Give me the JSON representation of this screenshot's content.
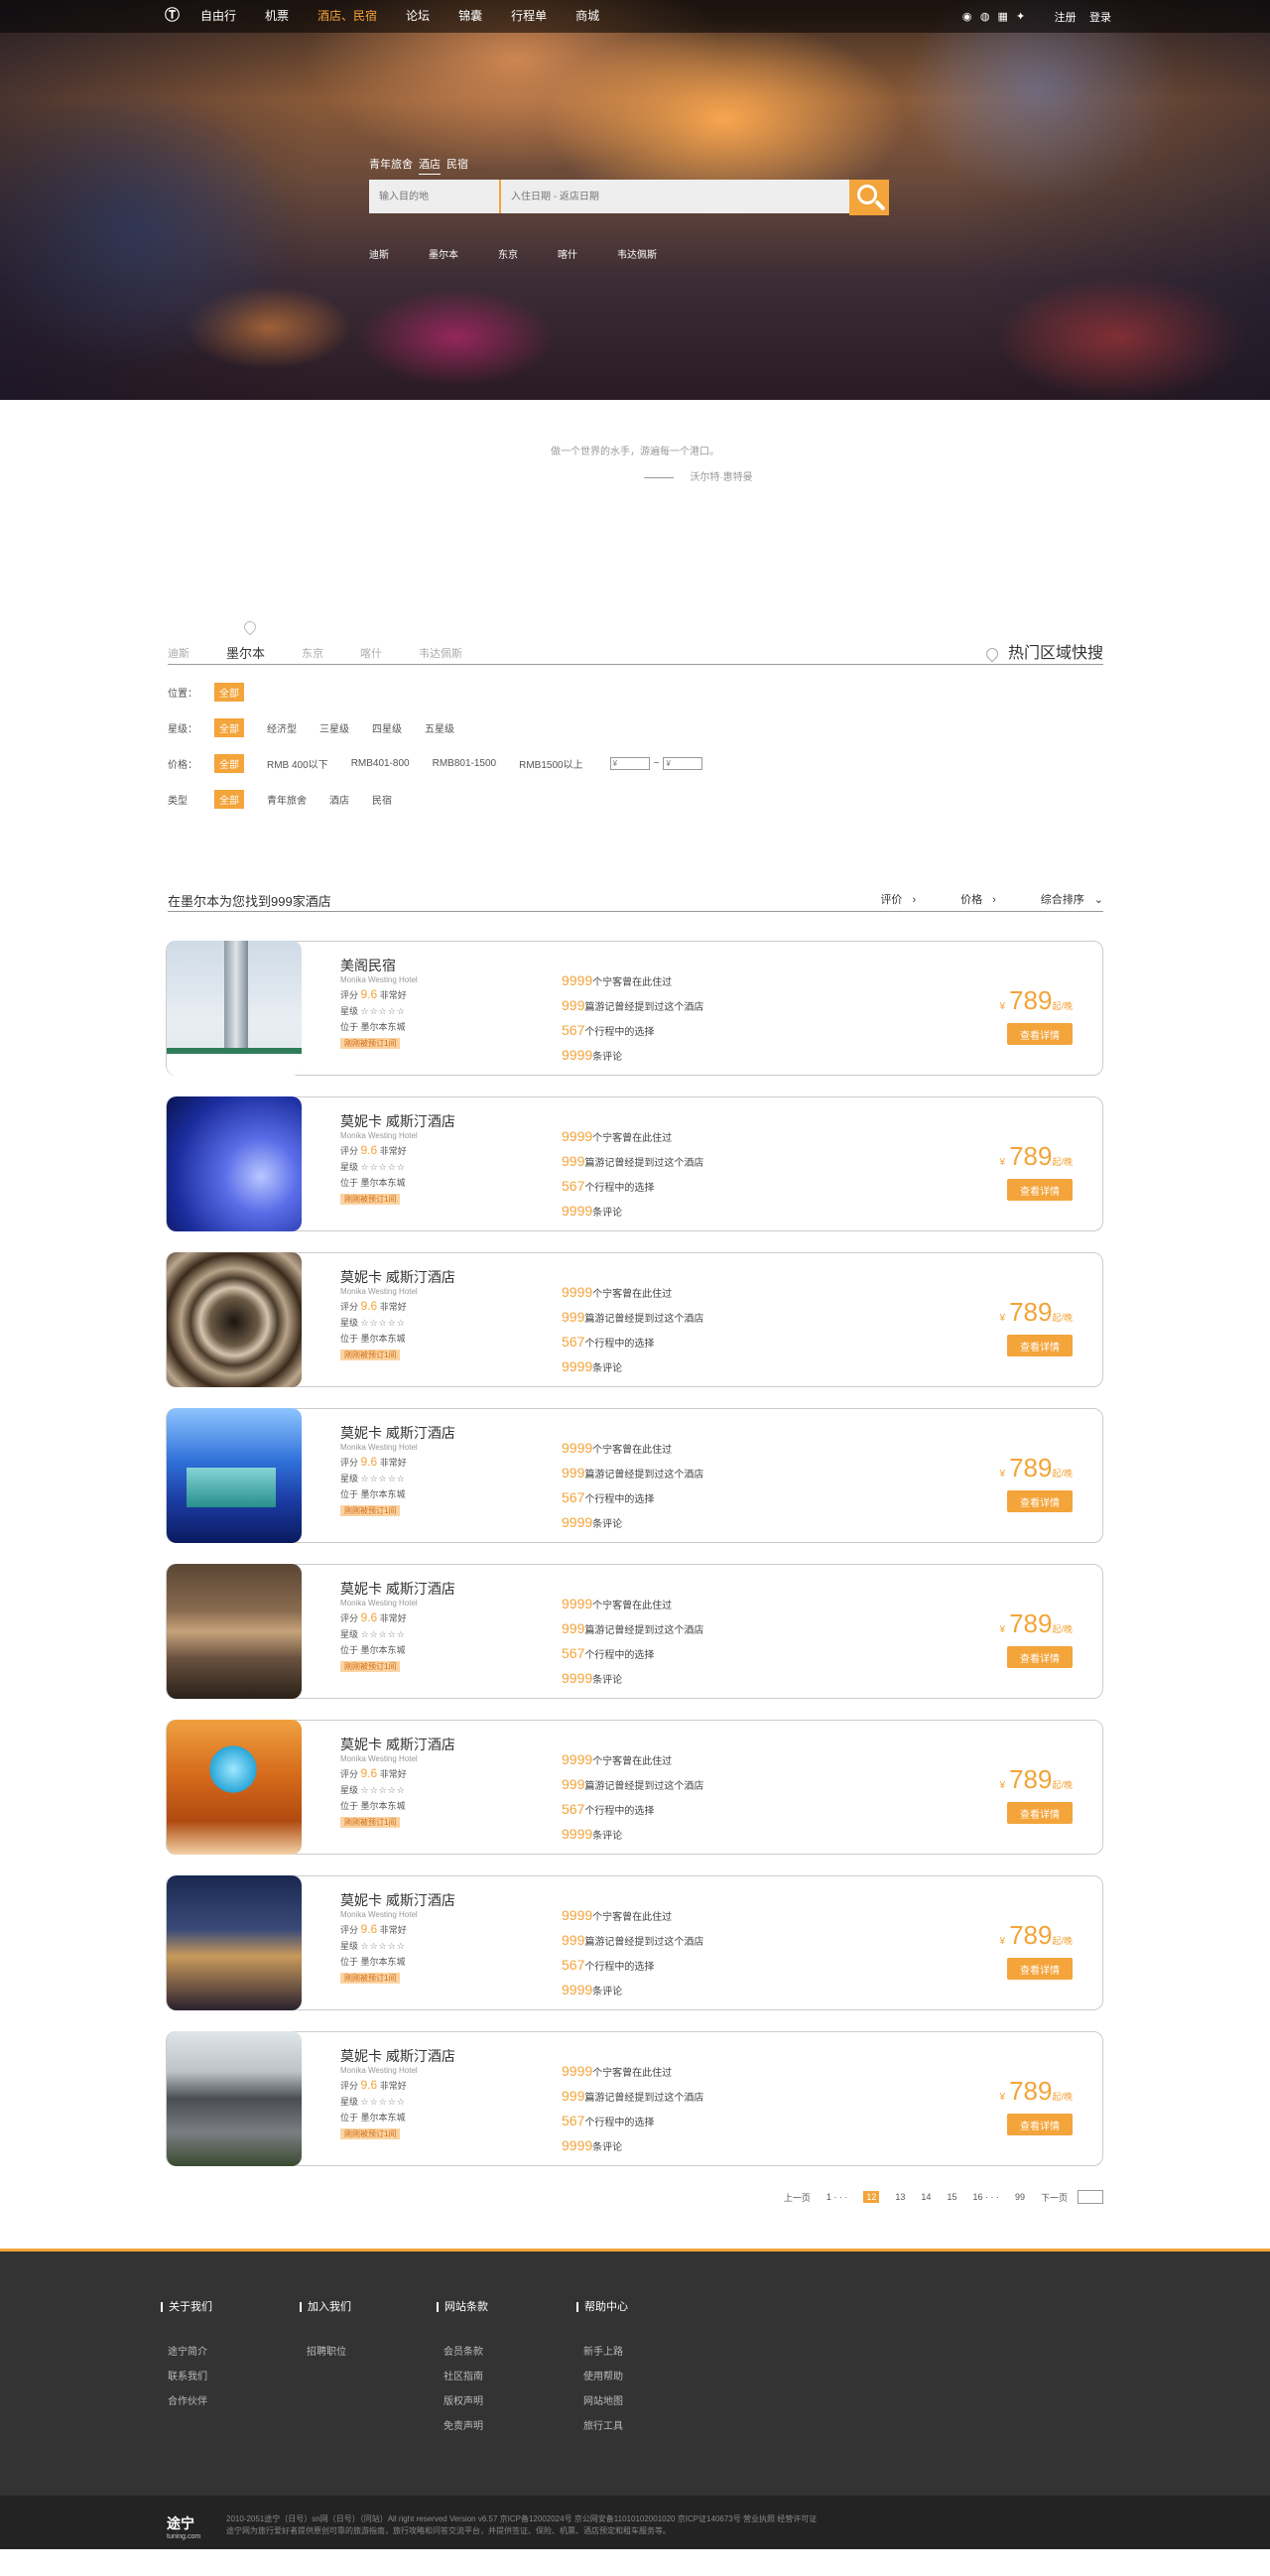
{
  "colors": {
    "accent": "#f3a43a",
    "footer_bg": "#333333",
    "bottom_bg": "#232323"
  },
  "header": {
    "logo_icon": "tuning-logo-icon",
    "nav": [
      "自由行",
      "机票",
      "酒店、民宿",
      "论坛",
      "锦囊",
      "行程单",
      "商城"
    ],
    "active_nav": "酒店、民宿",
    "social_icons": [
      "qq-icon",
      "wechat-icon",
      "grid-icon",
      "twitter-icon"
    ],
    "register": "注册",
    "login": "登录"
  },
  "hero": {
    "tabs": [
      "青年旅舍",
      "酒店",
      "民宿"
    ],
    "active_tab": "酒店",
    "destination_placeholder": "输入目的地",
    "date_placeholder": "入住日期 - 返店日期",
    "hot_cities": [
      "迪斯",
      "墨尔本",
      "东京",
      "喀什",
      "韦达佩斯"
    ]
  },
  "quote": {
    "text": "做一个世界的水手，游遍每一个港口。",
    "author": "沃尔特·惠特曼"
  },
  "city_tabs": {
    "items": [
      "迪斯",
      "墨尔本",
      "东京",
      "喀什",
      "韦达佩斯"
    ],
    "active": "墨尔本",
    "hot_area": "热门区域快搜"
  },
  "filters": {
    "location": {
      "label": "位置：",
      "options": [
        "全部"
      ]
    },
    "stars": {
      "label": "星级：",
      "options": [
        "全部",
        "经济型",
        "三星级",
        "四星级",
        "五星级"
      ]
    },
    "price": {
      "label": "价格：",
      "options": [
        "全部",
        "RMB 400以下",
        "RMB401-800",
        "RMB801-1500",
        "RMB1500以上"
      ],
      "min_placeholder": "¥",
      "sep": "~",
      "max_placeholder": "¥"
    },
    "type": {
      "label": "类型",
      "options": [
        "全部",
        "青年旅舍",
        "酒店",
        "民宿"
      ]
    }
  },
  "results": {
    "title": "在墨尔本为您找到999家酒店",
    "sorts": [
      "评价",
      "价格",
      "综合排序"
    ],
    "sort_icons": [
      "chevron-right-icon",
      "chevron-right-icon",
      "chevron-down-icon"
    ]
  },
  "hotels": [
    {
      "name": "美阁民宿",
      "en": "Monika Westing Hotel",
      "score_label": "评分",
      "score": "9.6",
      "score_desc": "非常好",
      "stars_label": "星级",
      "stars": "☆☆☆☆☆",
      "location": "位于 墨尔本东城",
      "tag": "刚刚被预订1间",
      "guests": "9999",
      "guests_text": "个宁客曾在此住过",
      "notes": "999",
      "notes_text": "篇游记曾经提到过这个酒店",
      "plans": "567",
      "plans_text": "个行程中的选择",
      "reviews": "9999",
      "reviews_text": "条评论",
      "currency": "¥",
      "price": "789",
      "unit": "起/晚",
      "button": "查看详情"
    },
    {
      "name": "莫妮卡 威斯汀酒店",
      "en": "Monika Westing Hotel",
      "score_label": "评分",
      "score": "9.6",
      "score_desc": "非常好",
      "stars_label": "星级",
      "stars": "☆☆☆☆☆",
      "location": "位于 墨尔本东城",
      "tag": "刚刚被预订1间",
      "guests": "9999",
      "guests_text": "个宁客曾在此住过",
      "notes": "999",
      "notes_text": "篇游记曾经提到过这个酒店",
      "plans": "567",
      "plans_text": "个行程中的选择",
      "reviews": "9999",
      "reviews_text": "条评论",
      "currency": "¥",
      "price": "789",
      "unit": "起/晚",
      "button": "查看详情"
    },
    {
      "name": "莫妮卡 威斯汀酒店",
      "en": "Monika Westing Hotel",
      "score_label": "评分",
      "score": "9.6",
      "score_desc": "非常好",
      "stars_label": "星级",
      "stars": "☆☆☆☆☆",
      "location": "位于 墨尔本东城",
      "tag": "刚刚被预订1间",
      "guests": "9999",
      "guests_text": "个宁客曾在此住过",
      "notes": "999",
      "notes_text": "篇游记曾经提到过这个酒店",
      "plans": "567",
      "plans_text": "个行程中的选择",
      "reviews": "9999",
      "reviews_text": "条评论",
      "currency": "¥",
      "price": "789",
      "unit": "起/晚",
      "button": "查看详情"
    },
    {
      "name": "莫妮卡 威斯汀酒店",
      "en": "Monika Westing Hotel",
      "score_label": "评分",
      "score": "9.6",
      "score_desc": "非常好",
      "stars_label": "星级",
      "stars": "☆☆☆☆☆",
      "location": "位于 墨尔本东城",
      "tag": "刚刚被预订1间",
      "guests": "9999",
      "guests_text": "个宁客曾在此住过",
      "notes": "999",
      "notes_text": "篇游记曾经提到过这个酒店",
      "plans": "567",
      "plans_text": "个行程中的选择",
      "reviews": "9999",
      "reviews_text": "条评论",
      "currency": "¥",
      "price": "789",
      "unit": "起/晚",
      "button": "查看详情"
    },
    {
      "name": "莫妮卡 威斯汀酒店",
      "en": "Monika Westing Hotel",
      "score_label": "评分",
      "score": "9.6",
      "score_desc": "非常好",
      "stars_label": "星级",
      "stars": "☆☆☆☆☆",
      "location": "位于 墨尔本东城",
      "tag": "刚刚被预订1间",
      "guests": "9999",
      "guests_text": "个宁客曾在此住过",
      "notes": "999",
      "notes_text": "篇游记曾经提到过这个酒店",
      "plans": "567",
      "plans_text": "个行程中的选择",
      "reviews": "9999",
      "reviews_text": "条评论",
      "currency": "¥",
      "price": "789",
      "unit": "起/晚",
      "button": "查看详情"
    },
    {
      "name": "莫妮卡 威斯汀酒店",
      "en": "Monika Westing Hotel",
      "score_label": "评分",
      "score": "9.6",
      "score_desc": "非常好",
      "stars_label": "星级",
      "stars": "☆☆☆☆☆",
      "location": "位于 墨尔本东城",
      "tag": "刚刚被预订1间",
      "guests": "9999",
      "guests_text": "个宁客曾在此住过",
      "notes": "999",
      "notes_text": "篇游记曾经提到过这个酒店",
      "plans": "567",
      "plans_text": "个行程中的选择",
      "reviews": "9999",
      "reviews_text": "条评论",
      "currency": "¥",
      "price": "789",
      "unit": "起/晚",
      "button": "查看详情"
    },
    {
      "name": "莫妮卡 威斯汀酒店",
      "en": "Monika Westing Hotel",
      "score_label": "评分",
      "score": "9.6",
      "score_desc": "非常好",
      "stars_label": "星级",
      "stars": "☆☆☆☆☆",
      "location": "位于 墨尔本东城",
      "tag": "刚刚被预订1间",
      "guests": "9999",
      "guests_text": "个宁客曾在此住过",
      "notes": "999",
      "notes_text": "篇游记曾经提到过这个酒店",
      "plans": "567",
      "plans_text": "个行程中的选择",
      "reviews": "9999",
      "reviews_text": "条评论",
      "currency": "¥",
      "price": "789",
      "unit": "起/晚",
      "button": "查看详情"
    },
    {
      "name": "莫妮卡 威斯汀酒店",
      "en": "Monika Westing Hotel",
      "score_label": "评分",
      "score": "9.6",
      "score_desc": "非常好",
      "stars_label": "星级",
      "stars": "☆☆☆☆☆",
      "location": "位于 墨尔本东城",
      "tag": "刚刚被预订1间",
      "guests": "9999",
      "guests_text": "个宁客曾在此住过",
      "notes": "999",
      "notes_text": "篇游记曾经提到过这个酒店",
      "plans": "567",
      "plans_text": "个行程中的选择",
      "reviews": "9999",
      "reviews_text": "条评论",
      "currency": "¥",
      "price": "789",
      "unit": "起/晚",
      "button": "查看详情"
    }
  ],
  "pagination": {
    "prev": "上一页",
    "pages": [
      "1 · · ·",
      "12",
      "13",
      "14",
      "15",
      "16 · · ·",
      "99"
    ],
    "current": "12",
    "next": "下一页"
  },
  "footer": {
    "columns": [
      {
        "title": "关于我们",
        "links": [
          "途宁简介",
          "联系我们",
          "合作伙伴"
        ]
      },
      {
        "title": "加入我们",
        "links": [
          "招聘职位"
        ]
      },
      {
        "title": "网站条款",
        "links": [
          "会员条款",
          "社区指南",
          "版权声明",
          "免责声明"
        ]
      },
      {
        "title": "帮助中心",
        "links": [
          "新手上路",
          "使用帮助",
          "网站地图",
          "旅行工具"
        ]
      }
    ],
    "brand": "途宁",
    "brand_url": "tuning.com",
    "copy_line1": "2010-2051途宁（日号）sn网（日号）（同站）All right reserved Version v6.57 京ICP备12002024号 京公网安备11010102001020 京ICP证140673号 营业执照 经营许可证",
    "copy_line2": "途宁网为旅行爱好者提供原创可靠的旅游指南，旅行攻略和问答交流平台，并提供签证、保险、机票、酒店预定和租车服务等。"
  }
}
